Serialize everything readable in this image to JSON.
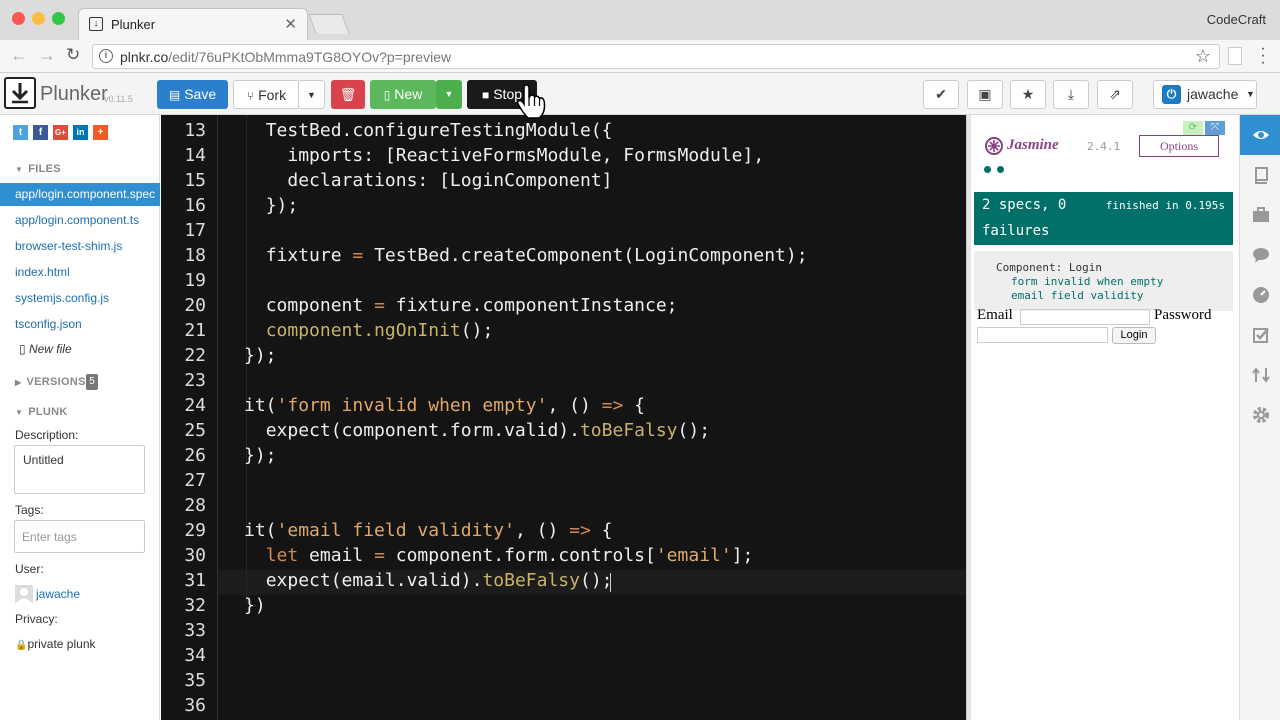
{
  "browser": {
    "tab_title": "Plunker",
    "tab_close": "✕",
    "profile_name": "CodeCraft",
    "url_host": "plnkr.co",
    "url_path": "/edit/76uPKtObMmma9TG8OYOv?p=preview",
    "info_glyph": "i",
    "star_glyph": "☆",
    "traffic_colors": [
      "#fc5753",
      "#fdbc40",
      "#33c748"
    ]
  },
  "toolbar": {
    "brand": "Plunker",
    "version": "v0.11.5",
    "save_label": "Save",
    "fork_label": "Fork",
    "new_label": "New",
    "stop_label": "Stop",
    "user_name": "jawache",
    "icons": [
      "check-icon",
      "briefcase-icon",
      "star-icon",
      "download-icon",
      "external-link-icon"
    ]
  },
  "sidebar": {
    "social": [
      "t",
      "f",
      "G+",
      "in",
      "+"
    ],
    "files_header": "FILES",
    "files": [
      "app/login.component.spec",
      "app/login.component.ts",
      "browser-test-shim.js",
      "index.html",
      "systemjs.config.js",
      "tsconfig.json"
    ],
    "new_file": "New file",
    "versions_header": "VERSIONS",
    "versions_count": "5",
    "plunk_header": "PLUNK",
    "description_label": "Description:",
    "description_value": "Untitled",
    "tags_label": "Tags:",
    "tags_placeholder": "Enter tags",
    "user_label": "User:",
    "user_value": "jawache",
    "privacy_label": "Privacy:",
    "privacy_value": "private plunk"
  },
  "editor": {
    "line_numbers": [
      "13",
      "14",
      "15",
      "16",
      "17",
      "18",
      "19",
      "20",
      "21",
      "22",
      "23",
      "24",
      "25",
      "26",
      "27",
      "28",
      "29",
      "30",
      "31",
      "32",
      "33",
      "34",
      "35",
      "36"
    ]
  },
  "preview": {
    "framework": "Jasmine",
    "version": "2.4.1",
    "options_label": "Options",
    "summary_line1": "2 specs, 0",
    "summary_line2": "failures",
    "finished": "finished in 0.195s",
    "suite": "Component: Login",
    "specs": [
      "form invalid when empty",
      "email field validity"
    ],
    "email_label": "Email",
    "password_label": "Password",
    "login_button": "Login",
    "status_color": "#007069"
  }
}
